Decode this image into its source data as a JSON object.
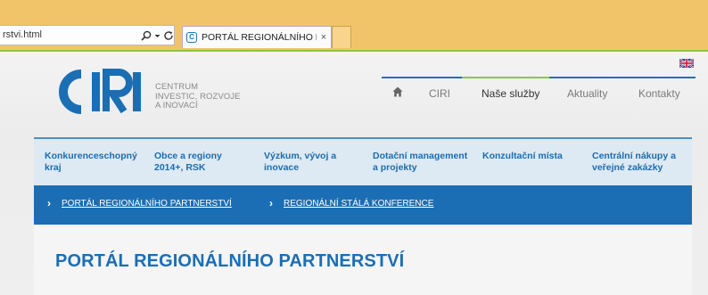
{
  "browser": {
    "address_text": "rstvi.html",
    "tab_title": "PORTÁL REGIONÁLNÍHO P...",
    "tab_close": "×"
  },
  "site": {
    "logo_text": [
      "CENTRUM",
      "INVESTIC, ROZVOJE",
      "A INOVACÍ"
    ],
    "logo_mark": "CIRI",
    "language_flag": "uk-flag-icon",
    "nav": {
      "home_icon": "home-icon",
      "items": [
        "CIRI",
        "Naše služby",
        "Aktuality",
        "Kontakty"
      ],
      "active": "Naše služby"
    },
    "subnav": [
      "Konkurenceschopný kraj",
      "Obce a regiony 2014+, RSK",
      "Výzkum, vývoj a inovace",
      "Dotační management a projekty",
      "Konzultační místa",
      "Centrální nákupy a veřejné zakázky"
    ],
    "breadcrumbs": [
      "PORTÁL REGIONÁLNÍHO PARTNERSTVÍ",
      "REGIONÁLNÍ STÁLÁ KONFERENCE"
    ],
    "page_title": "PORTÁL REGIONÁLNÍHO PARTNERSTVÍ",
    "colors": {
      "brand_blue": "#1b6eb4",
      "accent_green": "#8dc63f",
      "browser_chrome": "#f2c46a"
    }
  }
}
